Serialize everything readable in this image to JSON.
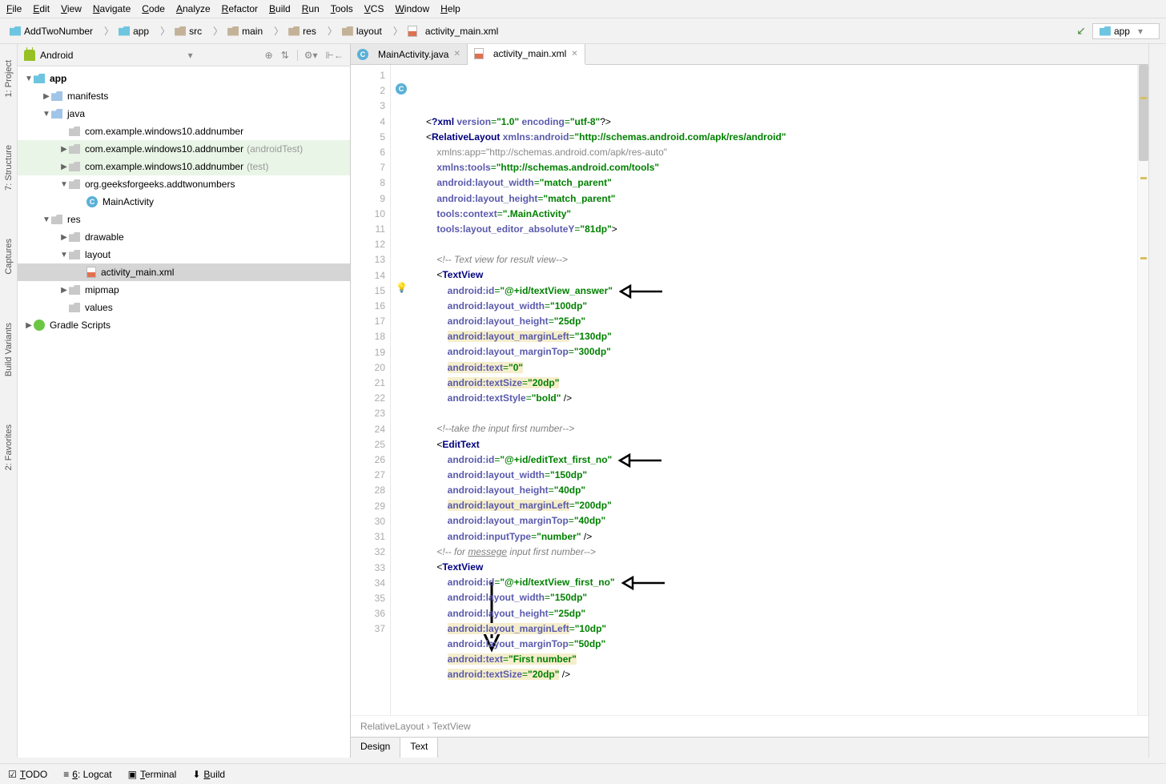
{
  "menu": {
    "items": [
      "File",
      "Edit",
      "View",
      "Navigate",
      "Code",
      "Analyze",
      "Refactor",
      "Build",
      "Run",
      "Tools",
      "VCS",
      "Window",
      "Help"
    ]
  },
  "breadcrumb": {
    "items": [
      {
        "label": "AddTwoNumber",
        "icon": "cyan"
      },
      {
        "label": "app",
        "icon": "cyan"
      },
      {
        "label": "src",
        "icon": "tan"
      },
      {
        "label": "main",
        "icon": "tan"
      },
      {
        "label": "res",
        "icon": "tan"
      },
      {
        "label": "layout",
        "icon": "tan"
      },
      {
        "label": "activity_main.xml",
        "icon": "xml"
      }
    ]
  },
  "run_config": "app",
  "sidebar_tabs": [
    "1: Project",
    "7: Structure",
    "Captures",
    "Build Variants",
    "2: Favorites"
  ],
  "project": {
    "header": "Android",
    "tree": [
      {
        "d": 0,
        "ar": "▼",
        "i": "cyan",
        "t": "app",
        "bold": true
      },
      {
        "d": 1,
        "ar": "▶",
        "i": "blue",
        "t": "manifests"
      },
      {
        "d": 1,
        "ar": "▼",
        "i": "blue",
        "t": "java"
      },
      {
        "d": 2,
        "ar": "",
        "i": "grey",
        "t": "com.example.windows10.addnumber"
      },
      {
        "d": 2,
        "ar": "▶",
        "i": "grey",
        "t": "com.example.windows10.addnumber",
        "suf": "(androidTest)",
        "hl": true
      },
      {
        "d": 2,
        "ar": "▶",
        "i": "grey",
        "t": "com.example.windows10.addnumber",
        "suf": "(test)",
        "hl": true
      },
      {
        "d": 2,
        "ar": "▼",
        "i": "grey",
        "t": "org.geeksforgeeks.addtwonumbers"
      },
      {
        "d": 3,
        "ar": "",
        "i": "c",
        "t": "MainActivity"
      },
      {
        "d": 1,
        "ar": "▼",
        "i": "grey",
        "t": "res"
      },
      {
        "d": 2,
        "ar": "▶",
        "i": "grey",
        "t": "drawable"
      },
      {
        "d": 2,
        "ar": "▼",
        "i": "grey",
        "t": "layout"
      },
      {
        "d": 3,
        "ar": "",
        "i": "xml",
        "t": "activity_main.xml",
        "sel": true
      },
      {
        "d": 2,
        "ar": "▶",
        "i": "grey",
        "t": "mipmap"
      },
      {
        "d": 2,
        "ar": "",
        "i": "grey",
        "t": "values"
      },
      {
        "d": 0,
        "ar": "▶",
        "i": "gradle",
        "t": "Gradle Scripts"
      }
    ]
  },
  "editor_tabs": [
    {
      "label": "MainActivity.java",
      "icon": "c",
      "active": false
    },
    {
      "label": "activity_main.xml",
      "icon": "xml",
      "active": true
    }
  ],
  "code": {
    "first_line": 1,
    "last_line": 37,
    "highlighted_line": 15,
    "lines": [
      {
        "n": 1,
        "h": "<span class='c-punct'>&lt;<span class='c-tag'>?xml</span> <span class='c-attr'>version</span><span class='c-eq'>=</span><span class='c-str'>\"1.0\"</span> <span class='c-attr'>encoding</span><span class='c-eq'>=</span><span class='c-str'>\"utf-8\"</span>?&gt;</span>"
      },
      {
        "n": 2,
        "h": "<span class='c-punct'>&lt;</span><span class='c-tag'>RelativeLayout</span> <span class='c-ns'>xmlns:</span><span class='c-attr'>android</span><span class='c-eq'>=</span><span class='c-str'>\"http://schemas.android.com/apk/res/android\"</span>"
      },
      {
        "n": 3,
        "h": "    <span class='c-grey'>xmlns:app=\"http://schemas.android.com/apk/res-auto\"</span>"
      },
      {
        "n": 4,
        "h": "    <span class='c-ns'>xmlns:</span><span class='c-attr'>tools</span><span class='c-eq'>=</span><span class='c-str'>\"http://schemas.android.com/tools\"</span>"
      },
      {
        "n": 5,
        "h": "    <span class='c-ns'>android:</span><span class='c-attr'>layout_width</span><span class='c-eq'>=</span><span class='c-str'>\"match_parent\"</span>"
      },
      {
        "n": 6,
        "h": "    <span class='c-ns'>android:</span><span class='c-attr'>layout_height</span><span class='c-eq'>=</span><span class='c-str'>\"match_parent\"</span>"
      },
      {
        "n": 7,
        "h": "    <span class='c-ns'>tools:</span><span class='c-attr'>context</span><span class='c-eq'>=</span><span class='c-str'>\".MainActivity\"</span>"
      },
      {
        "n": 8,
        "h": "    <span class='c-ns'>tools:</span><span class='c-attr'>layout_editor_absoluteY</span><span class='c-eq'>=</span><span class='c-str'>\"81dp\"</span><span class='c-punct'>&gt;</span>"
      },
      {
        "n": 9,
        "h": ""
      },
      {
        "n": 10,
        "h": "    <span class='c-comment'>&lt;!-- Text view for result view--&gt;</span>"
      },
      {
        "n": 11,
        "h": "    <span class='c-punct'>&lt;</span><span class='c-tag'>TextView</span>"
      },
      {
        "n": 12,
        "h": "        <span class='c-ns'>android:</span><span class='c-attr'>id</span><span class='c-eq'>=</span><span class='c-str'>\"@+id/textView_answer\"</span>",
        "arrow": true
      },
      {
        "n": 13,
        "h": "        <span class='c-ns'>android:</span><span class='c-attr'>layout_width</span><span class='c-eq'>=</span><span class='c-str'>\"100dp\"</span>"
      },
      {
        "n": 14,
        "h": "        <span class='c-ns'>android:</span><span class='c-attr'>layout_height</span><span class='c-eq'>=</span><span class='c-str'>\"25dp\"</span>"
      },
      {
        "n": 15,
        "h": "        <span class='hl-warn'><span class='c-ns'>android:</span><span class='c-attr'>layout_marginLeft</span></span><span class='c-eq'>=</span><span class='c-str'>\"130dp\"</span>",
        "line_hl": true
      },
      {
        "n": 16,
        "h": "        <span class='c-ns'>android:</span><span class='c-attr'>layout_marginTop</span><span class='c-eq'>=</span><span class='c-str'>\"300dp\"</span>"
      },
      {
        "n": 17,
        "h": "        <span class='hl-warn'><span class='c-ns'>android:</span><span class='c-attr'>text</span><span class='c-eq'>=</span><span class='c-str'>\"0\"</span></span>"
      },
      {
        "n": 18,
        "h": "        <span class='hl-warn'><span class='c-ns'>android:</span><span class='c-attr'>textSize</span><span class='c-eq'>=</span><span class='c-str'>\"20dp\"</span></span>"
      },
      {
        "n": 19,
        "h": "        <span class='c-ns'>android:</span><span class='c-attr'>textStyle</span><span class='c-eq'>=</span><span class='c-str'>\"bold\"</span> <span class='c-punct'>/&gt;</span>"
      },
      {
        "n": 20,
        "h": ""
      },
      {
        "n": 21,
        "h": "    <span class='c-comment'>&lt;!--take the input first number--&gt;</span>"
      },
      {
        "n": 22,
        "h": "    <span class='c-punct'>&lt;</span><span class='c-tag'>EditText</span>"
      },
      {
        "n": 23,
        "h": "        <span class='c-ns'>android:</span><span class='c-attr'>id</span><span class='c-eq'>=</span><span class='c-str'>\"@+id/editText_first_no\"</span>",
        "arrow": true
      },
      {
        "n": 24,
        "h": "        <span class='c-ns'>android:</span><span class='c-attr'>layout_width</span><span class='c-eq'>=</span><span class='c-str'>\"150dp\"</span>"
      },
      {
        "n": 25,
        "h": "        <span class='c-ns'>android:</span><span class='c-attr'>layout_height</span><span class='c-eq'>=</span><span class='c-str'>\"40dp\"</span>"
      },
      {
        "n": 26,
        "h": "        <span class='hl-warn'><span class='c-ns'>android:</span><span class='c-attr'>layout_marginLeft</span></span><span class='c-eq'>=</span><span class='c-str'>\"200dp\"</span>"
      },
      {
        "n": 27,
        "h": "        <span class='c-ns'>android:</span><span class='c-attr'>layout_marginTop</span><span class='c-eq'>=</span><span class='c-str'>\"40dp\"</span>"
      },
      {
        "n": 28,
        "h": "        <span class='c-ns'>android:</span><span class='c-attr'>inputType</span><span class='c-eq'>=</span><span class='c-str'>\"number\"</span> <span class='c-punct'>/&gt;</span>"
      },
      {
        "n": 29,
        "h": "    <span class='c-comment'>&lt;!-- for <u>messege</u> input first number--&gt;</span>"
      },
      {
        "n": 30,
        "h": "    <span class='c-punct'>&lt;</span><span class='c-tag'>TextView</span>"
      },
      {
        "n": 31,
        "h": "        <span class='c-ns'>android:</span><span class='c-attr'>id</span><span class='c-eq'>=</span><span class='c-str'>\"@+id/textView_first_no\"</span>",
        "arrow": true
      },
      {
        "n": 32,
        "h": "        <span class='c-ns'>android:</span><span class='c-attr'>layout_width</span><span class='c-eq'>=</span><span class='c-str'>\"150dp\"</span>"
      },
      {
        "n": 33,
        "h": "        <span class='c-ns'>android:</span><span class='c-attr'>layout_height</span><span class='c-eq'>=</span><span class='c-str'>\"25dp\"</span>"
      },
      {
        "n": 34,
        "h": "        <span class='hl-warn'><span class='c-ns'>android:</span><span class='c-attr'>layout_marginLeft</span></span><span class='c-eq'>=</span><span class='c-str'>\"10dp\"</span>"
      },
      {
        "n": 35,
        "h": "        <span class='c-ns'>android:</span><span class='c-attr'>layout_marginTop</span><span class='c-eq'>=</span><span class='c-str'>\"50dp\"</span>"
      },
      {
        "n": 36,
        "h": "        <span class='hl-warn'><span class='c-ns'>android:</span><span class='c-attr'>text</span><span class='c-eq'>=</span><span class='c-str'>\"First number\"</span></span>"
      },
      {
        "n": 37,
        "h": "        <span class='hl-warn'><span class='c-ns'>android:</span><span class='c-attr'>textSize</span><span class='c-eq'>=</span><span class='c-str'>\"20dp\"</span></span> <span class='c-punct'>/&gt;</span>"
      }
    ],
    "breadcrumb": [
      "RelativeLayout",
      "TextView"
    ]
  },
  "design_tabs": [
    "Design",
    "Text"
  ],
  "design_active": 1,
  "bottom": [
    "TODO",
    "6: Logcat",
    "Terminal",
    "Build"
  ]
}
